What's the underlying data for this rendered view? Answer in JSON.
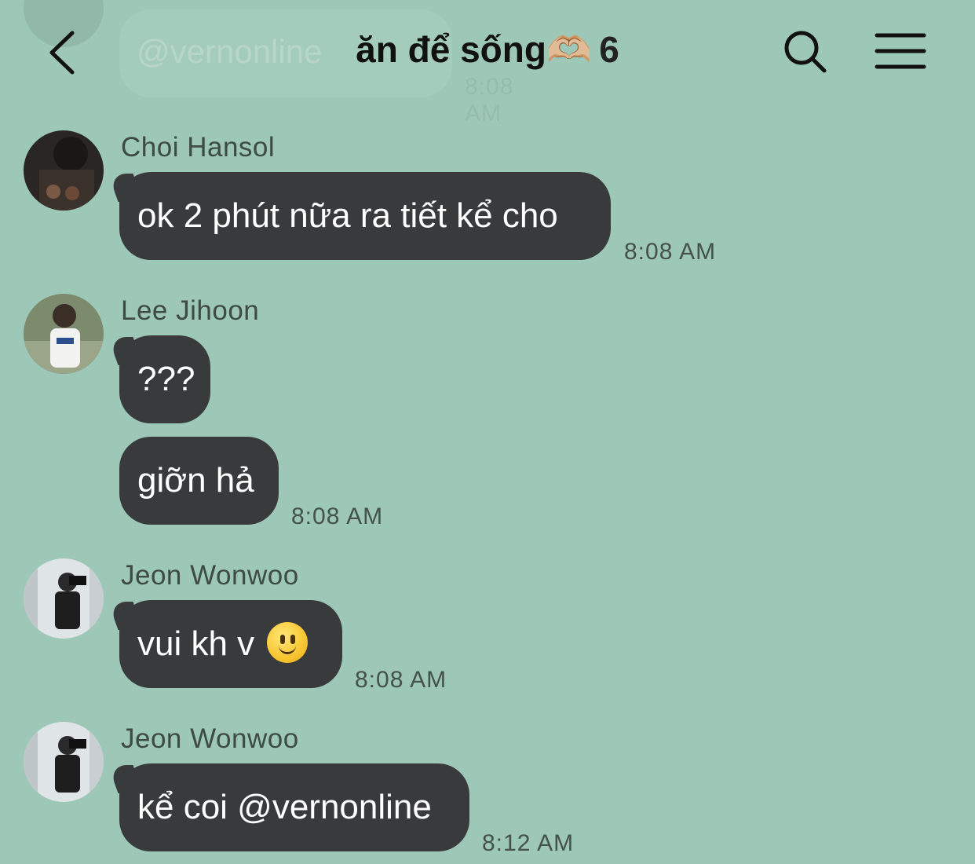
{
  "header": {
    "title": "ăn để sống🫶🏼",
    "member_count": "6"
  },
  "ghost": {
    "text": "@vernonline",
    "time": "8:08 AM"
  },
  "messages": [
    {
      "sender": "Choi Hansol",
      "text": "ok 2 phút nữa ra tiết kể cho",
      "time": "8:08 AM"
    },
    {
      "sender": "Lee Jihoon",
      "text": "???",
      "time": ""
    },
    {
      "sender": "",
      "text": "giỡn hả",
      "time": "8:08 AM"
    },
    {
      "sender": "Jeon Wonwoo",
      "text": "vui kh v",
      "emoji": "slightly-smiling-face",
      "time": "8:08 AM"
    },
    {
      "sender": "Jeon Wonwoo",
      "text": "kể coi @vernonline",
      "time": "8:12 AM"
    }
  ]
}
